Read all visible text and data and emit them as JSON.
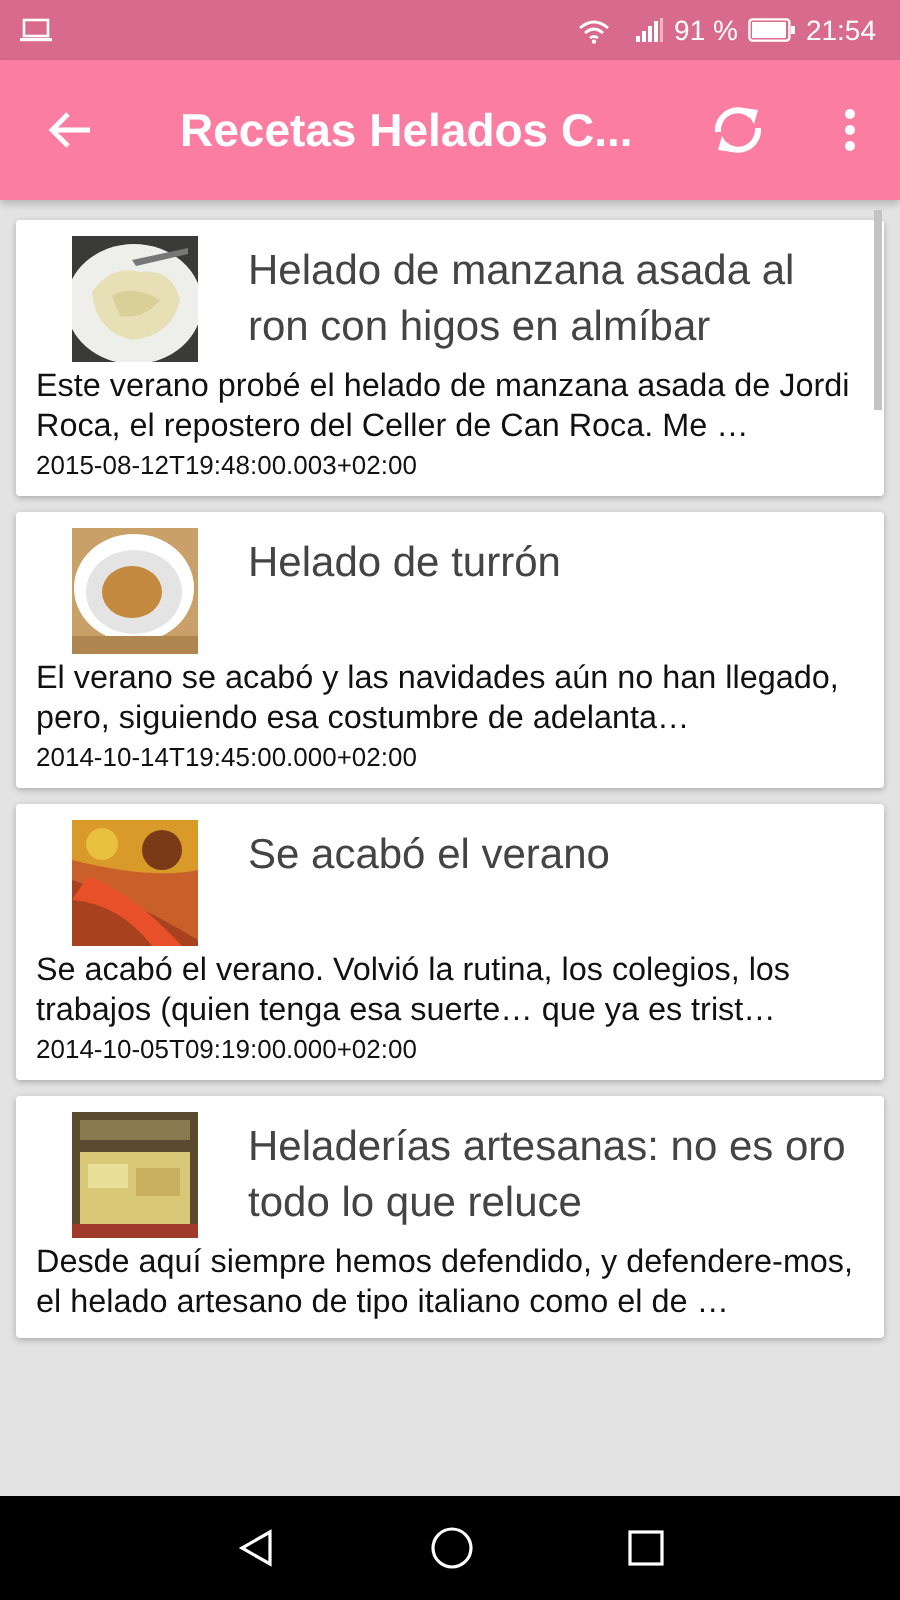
{
  "status_bar": {
    "battery_percent": "91 %",
    "time": "21:54"
  },
  "app_bar": {
    "title": "Recetas Helados C..."
  },
  "recipes": [
    {
      "kind": "picture",
      "title": "Helado de manzana asada al ron con higos en almíbar",
      "excerpt": "Este verano probé el helado de manzana asada de Jordi Roca, el repostero del Celler de Can Roca. Me …",
      "date": "2015-08-12T19:48:00.003+02:00"
    },
    {
      "kind": "picture",
      "title": "Helado de turrón",
      "excerpt": "El verano se acabó y las navidades aún no han llegado, pero, siguiendo esa costumbre de adelanta…",
      "date": "2014-10-14T19:45:00.000+02:00"
    },
    {
      "kind": "picture",
      "title": "Se acabó el verano",
      "excerpt": "Se acabó el verano. Volvió la rutina, los colegios, los trabajos (quien tenga esa suerte… que ya es trist…",
      "date": "2014-10-05T09:19:00.000+02:00"
    },
    {
      "kind": "picture",
      "title": "Heladerías artesanas: no es oro todo lo que reluce",
      "excerpt": "Desde aquí siempre hemos defendido, y defendere-mos, el helado artesano de tipo italiano como el de …"
    }
  ]
}
